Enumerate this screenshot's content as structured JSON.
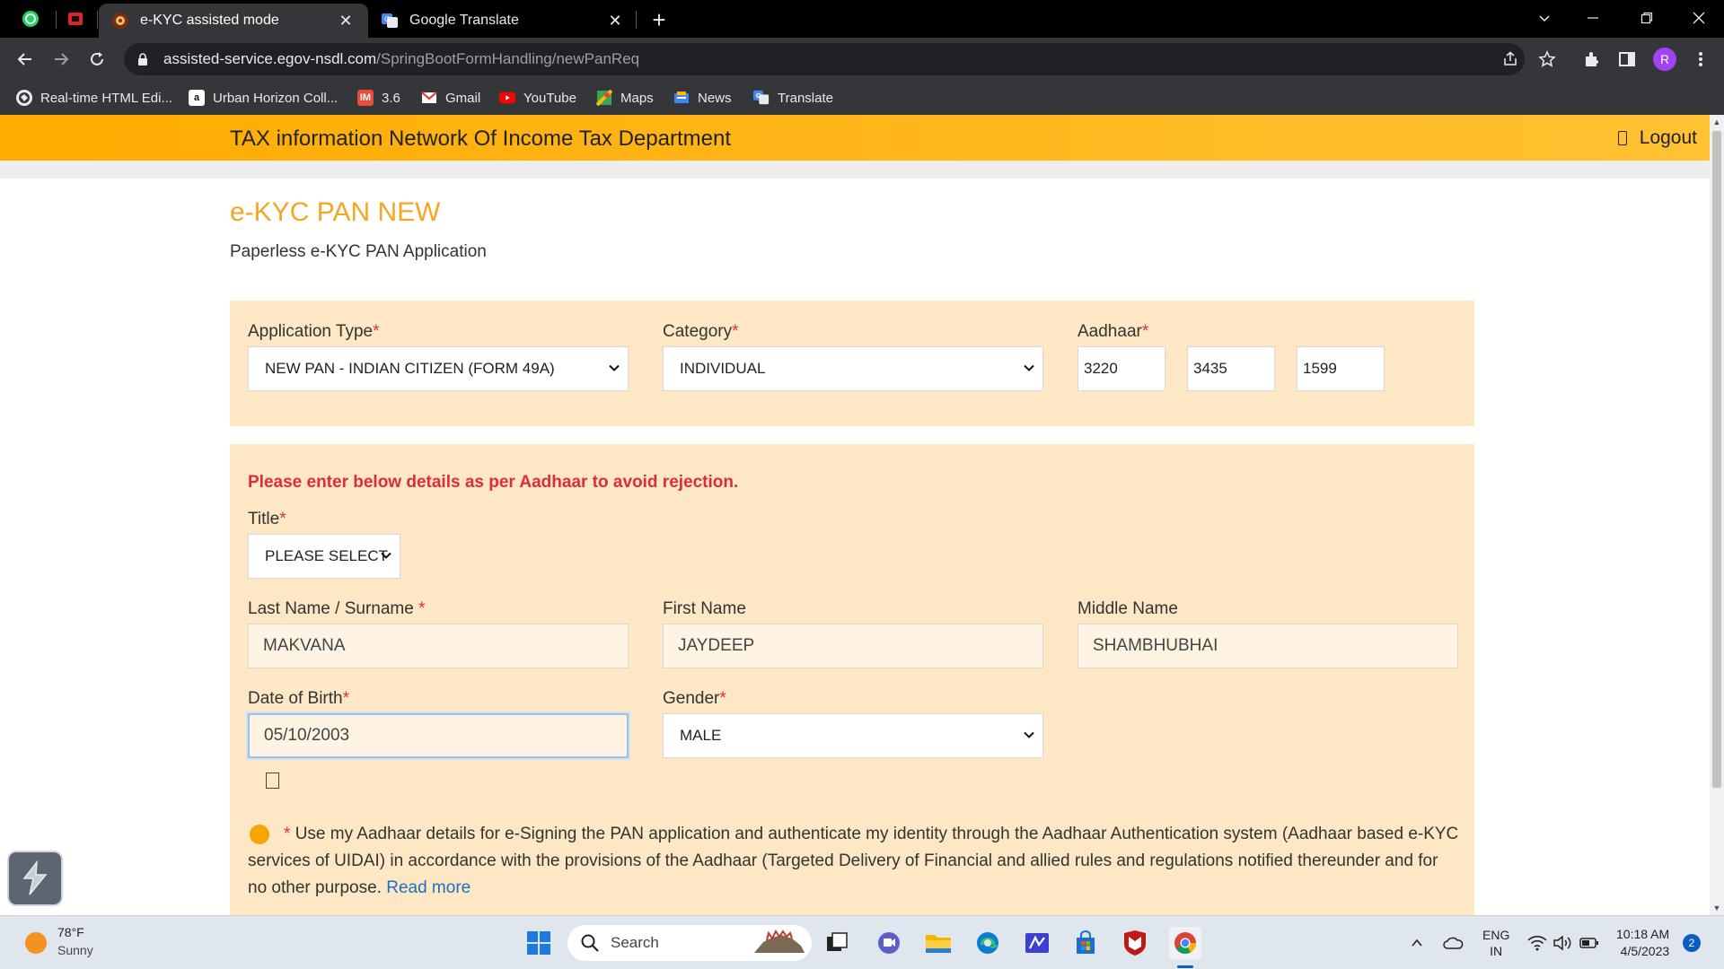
{
  "browser": {
    "tabs": [
      {
        "title": "e-KYC assisted mode",
        "active": true
      },
      {
        "title": "Google Translate",
        "active": false
      }
    ],
    "url_host": "assisted-service.egov-nsdl.com",
    "url_path": "/SpringBootFormHandling/newPanReq",
    "profile_initial": "R",
    "bookmarks": [
      {
        "label": "Real-time HTML Edi...",
        "icon": "globe-icon"
      },
      {
        "label": "Urban Horizon Coll...",
        "icon": "urban-horizon-icon"
      },
      {
        "label": "3.6",
        "icon": "im-icon"
      },
      {
        "label": "Gmail",
        "icon": "gmail-icon"
      },
      {
        "label": "YouTube",
        "icon": "youtube-icon"
      },
      {
        "label": "Maps",
        "icon": "maps-icon"
      },
      {
        "label": "News",
        "icon": "news-icon"
      },
      {
        "label": "Translate",
        "icon": "translate-icon"
      }
    ]
  },
  "page": {
    "header_title": "TAX information Network Of Income Tax Department",
    "logout_label": "Logout",
    "heading": "e-KYC PAN NEW",
    "subheading": "Paperless e-KYC PAN Application",
    "required_mark": "*",
    "application_type": {
      "label": "Application Type",
      "value": "NEW PAN - INDIAN CITIZEN (FORM 49A)"
    },
    "category": {
      "label": "Category",
      "value": "INDIVIDUAL"
    },
    "aadhaar": {
      "label": "Aadhaar",
      "part1": "3220",
      "part2": "3435",
      "part3": "1599"
    },
    "warning": "Please enter below details as per Aadhaar to avoid rejection.",
    "title_field": {
      "label": "Title",
      "value": "PLEASE SELECT"
    },
    "last_name": {
      "label": "Last Name / Surname ",
      "value": "MAKVANA"
    },
    "first_name": {
      "label": "First Name",
      "value": "JAYDEEP"
    },
    "middle_name": {
      "label": "Middle Name",
      "value": "SHAMBHUBHAI"
    },
    "dob": {
      "label": "Date of Birth",
      "value": "05/10/2003"
    },
    "gender": {
      "label": "Gender",
      "value": "MALE"
    },
    "consent_text": "Use my Aadhaar details for e-Signing the PAN application and authenticate my identity through the Aadhaar Authentication system (Aadhaar based e-KYC services of UIDAI) in accordance with the provisions of the Aadhaar (Targeted Delivery of Financial and allied rules and regulations notified thereunder and for no other purpose.",
    "read_more": "Read more"
  },
  "taskbar": {
    "weather_temp": "78°F",
    "weather_desc": "Sunny",
    "search_placeholder": "Search",
    "lang_line1": "ENG",
    "lang_line2": "IN",
    "time": "10:18 AM",
    "date": "4/5/2023",
    "notification_count": "2"
  },
  "colors": {
    "header_orange": "#ffab00",
    "panel_bg": "#fde7c4",
    "heading_orange": "#f5a623",
    "warning_red": "#dd2c3c",
    "link_blue": "#1a6fc7"
  }
}
